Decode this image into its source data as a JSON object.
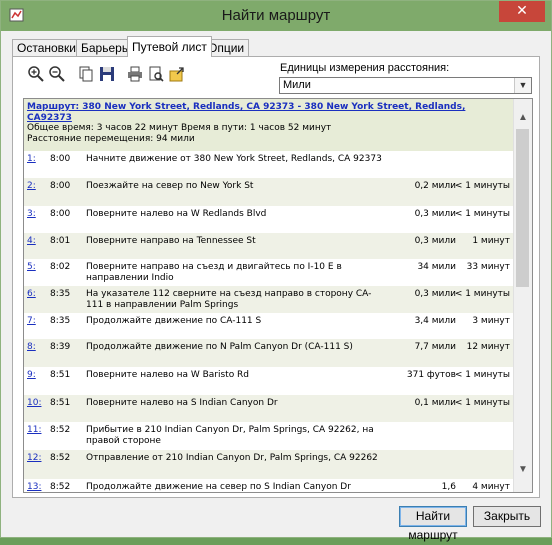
{
  "window": {
    "title": "Найти маршрут",
    "close_glyph": "✕"
  },
  "tabs": [
    {
      "label": "Остановки",
      "active": false
    },
    {
      "label": "Барьеры",
      "active": false
    },
    {
      "label": "Путевой лист",
      "active": true
    },
    {
      "label": "Опции",
      "active": false
    }
  ],
  "toolbar": {
    "icons": [
      "zoom-in-icon",
      "zoom-out-icon",
      "copy-icon",
      "save-icon",
      "print-icon",
      "print-preview-icon",
      "export-icon"
    ]
  },
  "units": {
    "label": "Единицы измерения расстояния:",
    "selected": "Мили"
  },
  "route": {
    "title": "Маршрут: 380 New York Street, Redlands, CA 92373 - 380 New York Street, Redlands, CA92373",
    "total_time": "Общее время: 3 часов 22 минут Время в пути: 1 часов 52 минут",
    "total_distance": "Расстояние перемещения: 94 мили"
  },
  "steps": [
    {
      "n": "1:",
      "time": "8:00",
      "desc": "Начните движение от 380 New York Street, Redlands, CA 92373",
      "dist": "",
      "dur": ""
    },
    {
      "n": "2:",
      "time": "8:00",
      "desc": "Поезжайте на север по New York St",
      "dist": "0,2 мили",
      "dur": "< 1 минуты"
    },
    {
      "n": "3:",
      "time": "8:00",
      "desc": "Поверните налево на W Redlands Blvd",
      "dist": "0,3 мили",
      "dur": "< 1 минуты"
    },
    {
      "n": "4:",
      "time": "8:01",
      "desc": "Поверните направо на Tennessee St",
      "dist": "0,3 мили",
      "dur": "1 минут"
    },
    {
      "n": "5:",
      "time": "8:02",
      "desc": "Поверните направо на съезд и двигайтесь по I-10 E в направлении Indio",
      "dist": "34 мили",
      "dur": "33 минут"
    },
    {
      "n": "6:",
      "time": "8:35",
      "desc": "На указателе 112 сверните на съезд направо в сторону CA-111 в направлении Palm Springs",
      "dist": "0,3 мили",
      "dur": "< 1 минуты"
    },
    {
      "n": "7:",
      "time": "8:35",
      "desc": "Продолжайте движение по CA-111 S",
      "dist": "3,4 мили",
      "dur": "3 минут"
    },
    {
      "n": "8:",
      "time": "8:39",
      "desc": "Продолжайте движение по N Palm Canyon Dr (CA-111 S)",
      "dist": "7,7 мили",
      "dur": "12 минут"
    },
    {
      "n": "9:",
      "time": "8:51",
      "desc": "Поверните налево на W Baristo Rd",
      "dist": "371 футов",
      "dur": "< 1 минуты"
    },
    {
      "n": "10:",
      "time": "8:51",
      "desc": "Поверните налево на S Indian Canyon Dr",
      "dist": "0,1 мили",
      "dur": "< 1 минуты"
    },
    {
      "n": "11:",
      "time": "8:52",
      "desc": "Прибытие в 210 Indian Canyon Dr, Palm Springs, CA 92262, на правой стороне",
      "dist": "",
      "dur": ""
    },
    {
      "n": "12:",
      "time": "8:52",
      "desc": "Отправление от 210 Indian Canyon Dr, Palm Springs, CA 92262",
      "dist": "",
      "dur": ""
    },
    {
      "n": "13:",
      "time": "8:52",
      "desc": "Продолжайте движение на север по S Indian Canyon Dr",
      "dist": "1,6",
      "dur": "4 минут"
    }
  ],
  "buttons": {
    "find": "Найти маршрут",
    "close": "Закрыть"
  }
}
